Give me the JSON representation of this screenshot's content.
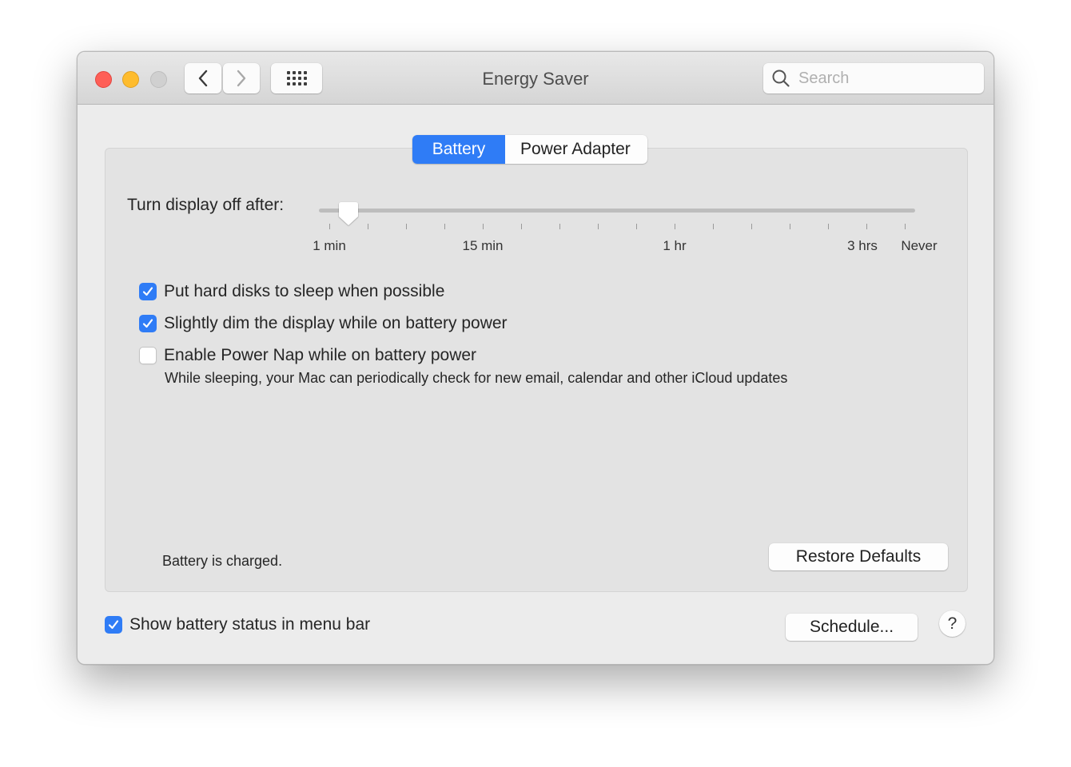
{
  "window": {
    "title": "Energy Saver",
    "controls": {
      "close_color": "#fe5f57",
      "minimize_color": "#febc2e",
      "zoom_color": "#d0d0d0"
    },
    "toolbar": {
      "back_icon": "chevron-left-icon",
      "forward_icon": "chevron-right-icon",
      "grid_icon": "show-all-grid-icon"
    },
    "search": {
      "placeholder": "Search",
      "value": ""
    }
  },
  "tabs": [
    {
      "label": "Battery",
      "selected": true
    },
    {
      "label": "Power Adapter",
      "selected": false
    }
  ],
  "accent_color": "#2f7cf6",
  "display_sleep": {
    "label": "Turn display off after:",
    "value": "2 min",
    "tick_count": 16,
    "selected_position_fraction": 0.033,
    "tick_labels": [
      {
        "text": "1 min",
        "tick_index": 0
      },
      {
        "text": "15 min",
        "tick_index": 4
      },
      {
        "text": "1 hr",
        "tick_index": 9
      },
      {
        "text": "3 hrs",
        "tick_index": 14
      },
      {
        "text": "Never",
        "tick_index": 15
      }
    ]
  },
  "options": [
    {
      "label": "Put hard disks to sleep when possible",
      "checked": true
    },
    {
      "label": "Slightly dim the display while on battery power",
      "checked": true
    },
    {
      "label": "Enable Power Nap while on battery power",
      "checked": false,
      "note": "While sleeping, your Mac can periodically check for new email, calendar and other iCloud updates"
    }
  ],
  "battery_status": "Battery is charged.",
  "buttons": {
    "restore_defaults": "Restore Defaults",
    "schedule": "Schedule...",
    "help": "?"
  },
  "show_battery_status": {
    "label": "Show battery status in menu bar",
    "checked": true
  }
}
